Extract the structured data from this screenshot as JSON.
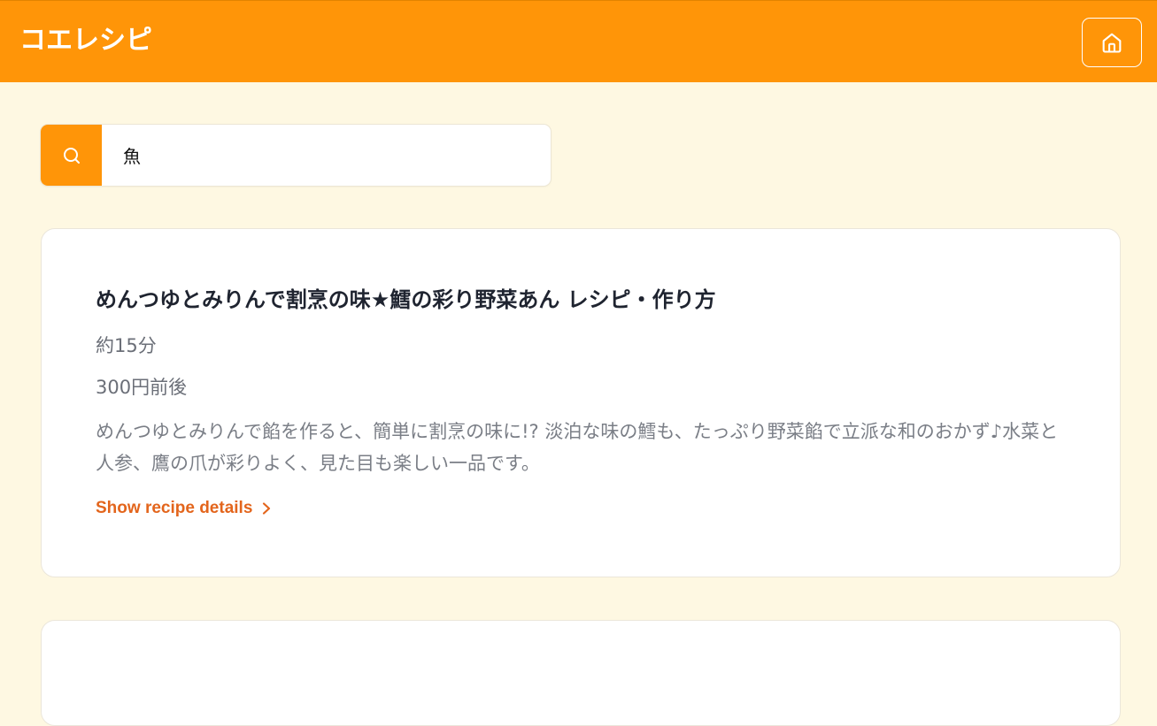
{
  "header": {
    "app_title": "コエレシピ",
    "home_icon": "home-icon"
  },
  "search": {
    "icon": "search-icon",
    "value": "魚",
    "placeholder": ""
  },
  "results": [
    {
      "title": "めんつゆとみりんで割烹の味★鱈の彩り野菜あん レシピ・作り方",
      "time": "約15分",
      "price": "300円前後",
      "description": "めんつゆとみりんで餡を作ると、簡単に割烹の味に!? 淡泊な味の鱈も、たっぷり野菜餡で立派な和のおかず♪水菜と人参、鷹の爪が彩りよく、見た目も楽しい一品です。",
      "details_label": "Show recipe details"
    }
  ],
  "colors": {
    "accent": "#ff9508",
    "background": "#fef8e2",
    "link": "#e3651c"
  }
}
